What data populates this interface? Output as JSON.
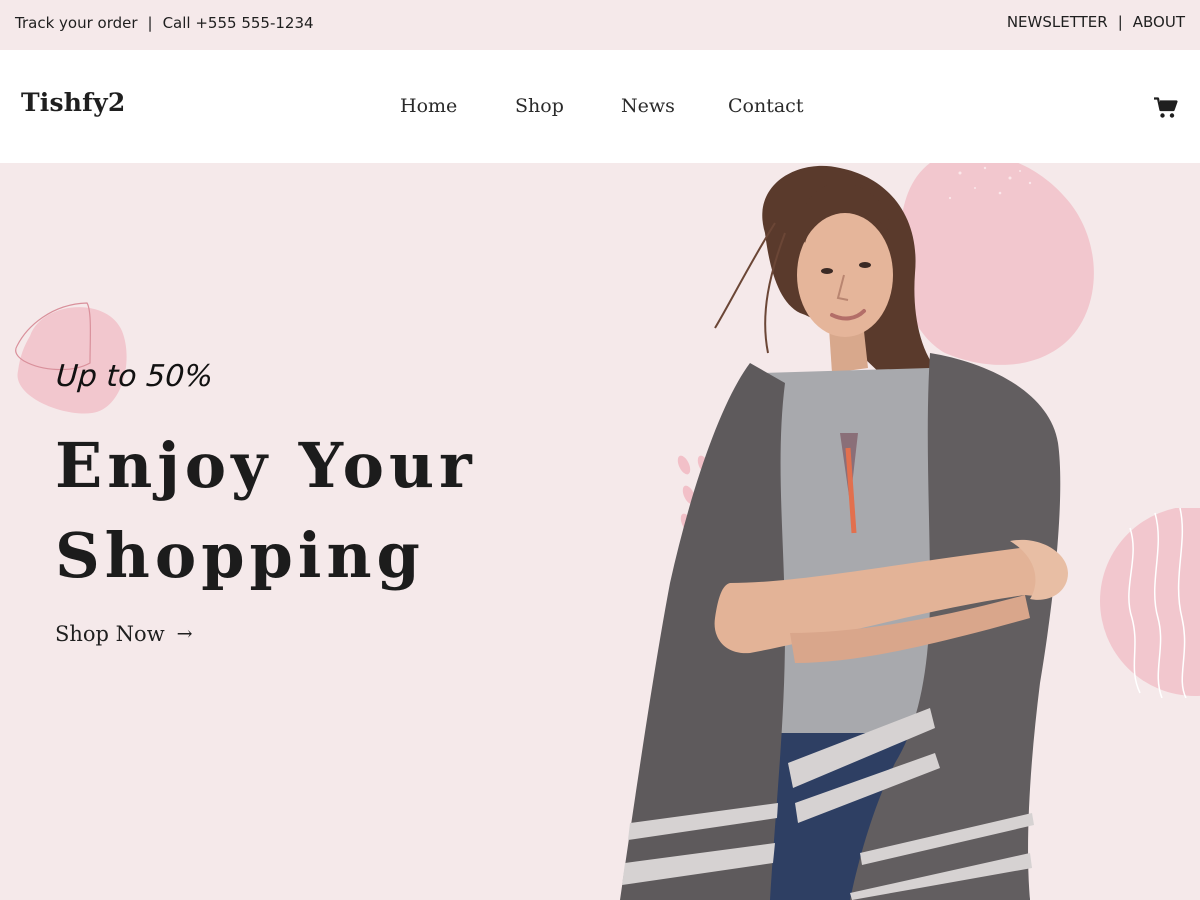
{
  "topbar": {
    "track_order": "Track your order",
    "separator": "|",
    "phone": "Call +555 555-1234",
    "newsletter": "NEWSLETTER",
    "about": "ABOUT"
  },
  "header": {
    "logo": "Tishfy2",
    "nav": [
      {
        "label": "Home"
      },
      {
        "label": "Shop"
      },
      {
        "label": "News"
      },
      {
        "label": "Contact"
      }
    ],
    "cart_icon": "shopping-cart-icon"
  },
  "hero": {
    "promo": "Up to 50%",
    "title_line1": "Enjoy Your",
    "title_line2": "Shopping",
    "cta": "Shop Now",
    "cta_arrow": "→"
  },
  "colors": {
    "background": "#f5e9ea",
    "header_bg": "#ffffff",
    "accent_pink": "#f2c7ce",
    "text": "#1f1f1f"
  }
}
